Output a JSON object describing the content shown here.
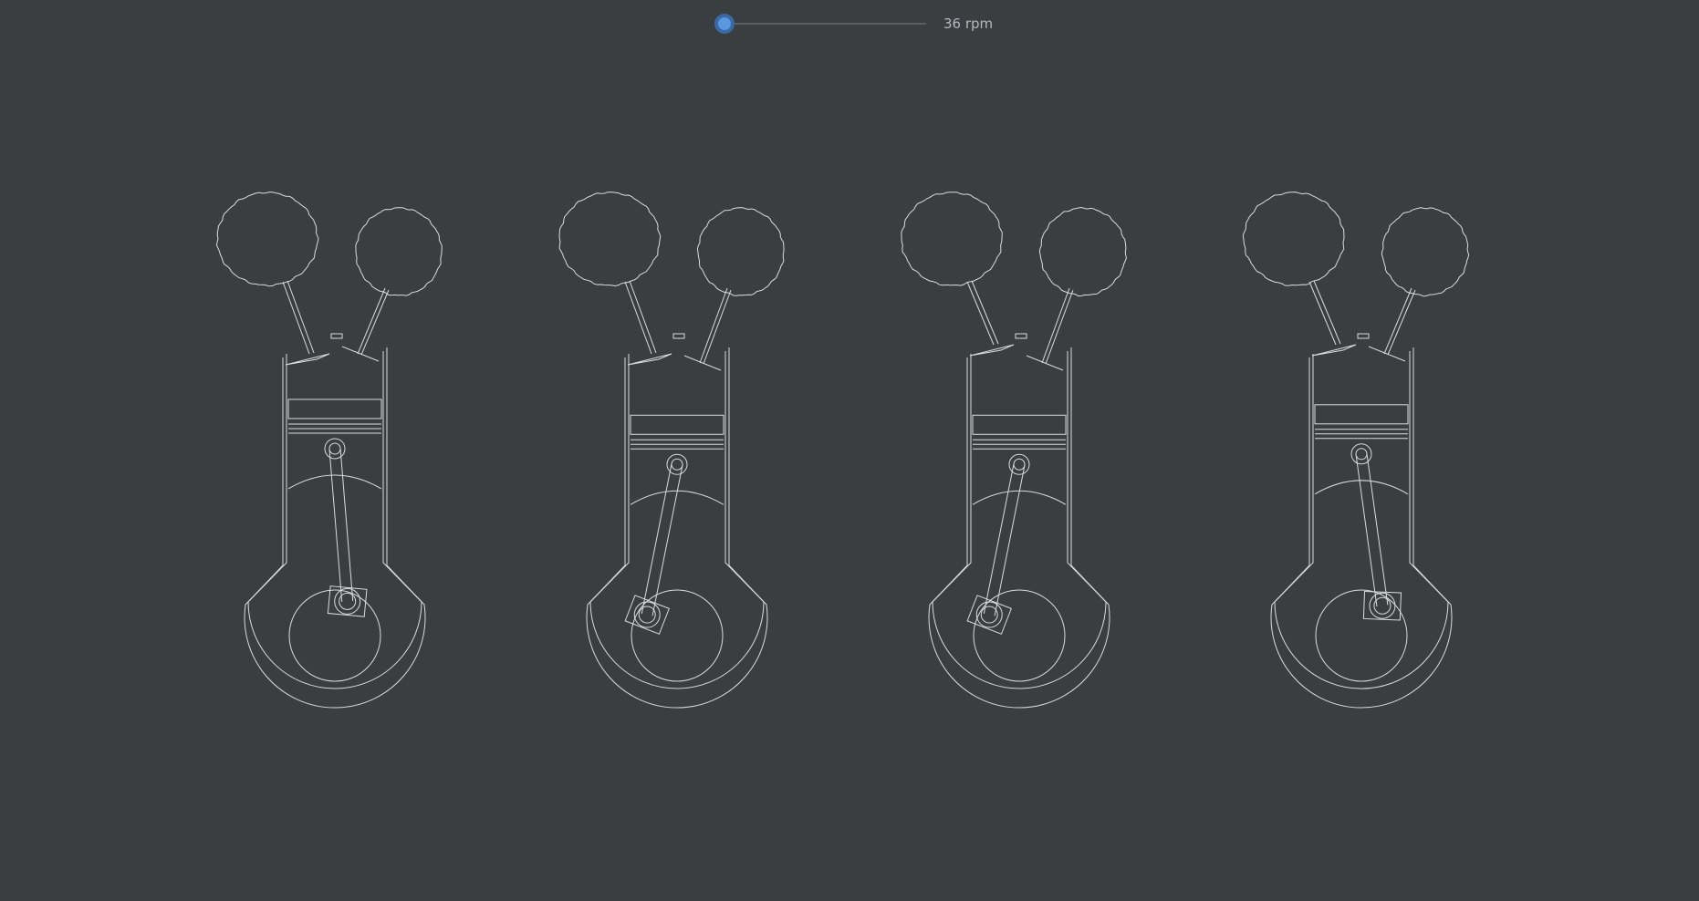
{
  "control": {
    "rpm": 36,
    "rpm_min": 0,
    "rpm_max": 1000,
    "rpm_text": "36 rpm"
  },
  "colors": {
    "background": "#3b3e41",
    "line": "#d9dcdf",
    "accent": "#5b96e0"
  },
  "cylinders": [
    {
      "crank_angle_deg": 160,
      "stroke": "down",
      "intake_valve": "open",
      "exhaust_valve": "closed"
    },
    {
      "crank_angle_deg": 235,
      "stroke": "up",
      "intake_valve": "open",
      "exhaust_valve": "open"
    },
    {
      "crank_angle_deg": 235,
      "stroke": "up",
      "intake_valve": "closed",
      "exhaust_valve": "open"
    },
    {
      "crank_angle_deg": 145,
      "stroke": "down",
      "intake_valve": "closed",
      "exhaust_valve": "closed"
    }
  ]
}
